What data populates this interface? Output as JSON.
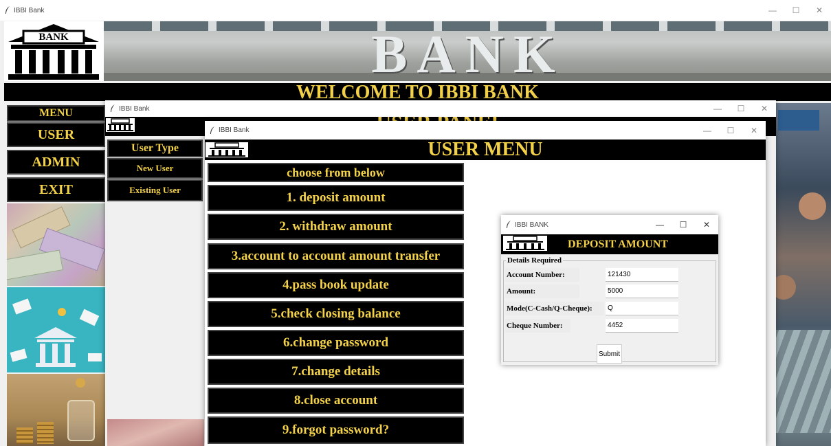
{
  "main_window": {
    "title": "IBBI Bank",
    "banner_text": "BANK",
    "logo_text": "BANK",
    "welcome": "WELCOME TO IBBI BANK",
    "menu_title": "MENU",
    "menu_items": [
      "USER",
      "ADMIN",
      "EXIT"
    ]
  },
  "user_panel": {
    "title": "IBBI Bank",
    "heading": "USER PANEL",
    "logo_text": "BANK",
    "user_type_label": "User Type",
    "options": [
      "New User",
      "Existing User"
    ]
  },
  "user_menu": {
    "title": "IBBI Bank",
    "heading": "USER MENU",
    "logo_text": "BANK",
    "choose_label": "choose from below",
    "items": [
      "1. deposit amount",
      "2. withdraw amount",
      "3.account to account amount transfer",
      "4.pass book update",
      "5.check closing balance",
      "6.change password",
      "7.change details",
      "8.close account",
      "9.forgot password?"
    ]
  },
  "deposit": {
    "title": "IBBI BANK",
    "heading": "DEPOSIT AMOUNT",
    "logo_text": "BANK",
    "group_label": "Details Required",
    "fields": [
      {
        "label": "Account Number:",
        "value": "121430"
      },
      {
        "label": "Amount:",
        "value": "5000"
      },
      {
        "label": "Mode(C-Cash/Q-Cheque):",
        "value": "Q"
      },
      {
        "label": "Cheque Number:",
        "value": "4452"
      }
    ],
    "submit_label": "Submit"
  },
  "window_controls": {
    "minimize": "—",
    "maximize": "☐",
    "close": "✕"
  },
  "colors": {
    "accent_text": "#f3d24a",
    "button_bg": "#000000",
    "window_bg": "#f0f0f0"
  }
}
